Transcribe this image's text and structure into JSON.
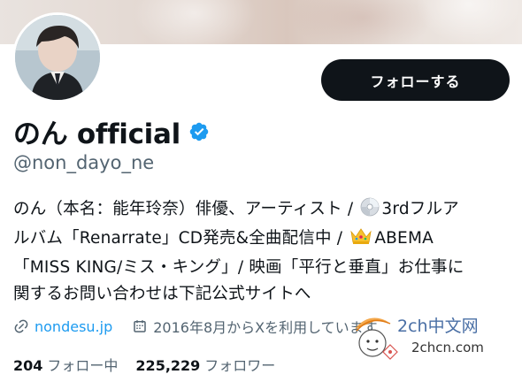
{
  "profile": {
    "display_name": "のん official",
    "handle": "@non_dayo_ne",
    "follow_label": "フォローする",
    "bio_lines": [
      {
        "parts": [
          "のん（本名：能年玲奈）俳優、アーティスト / ",
          "3rdフルア"
        ],
        "emoji": "disc-icon"
      },
      {
        "parts": [
          "ルバム「Renarrate」CD発売&全曲配信中 / ",
          "ABEMA"
        ],
        "emoji": "crown-icon"
      },
      {
        "parts": [
          "「MISS KING/ミス・キング」/ 映画「平行と垂直」お仕事に"
        ]
      },
      {
        "parts": [
          "関するお問い合わせは下記公式サイトへ"
        ]
      }
    ],
    "website": "nondesu.jp",
    "joined": "2016年8月からXを利用しています",
    "following_count": "204",
    "following_label": "フォロー中",
    "followers_count": "225,229",
    "followers_label": "フォロワー"
  },
  "watermark": {
    "line1": "2ch中文网",
    "line2": "2chcn.com"
  },
  "colors": {
    "accent": "#1d9bf0",
    "text": "#0f1419",
    "muted": "#536471",
    "button_bg": "#0f1419"
  },
  "icons": [
    "verified-badge-icon",
    "link-icon",
    "calendar-icon",
    "disc-icon",
    "crown-icon"
  ]
}
